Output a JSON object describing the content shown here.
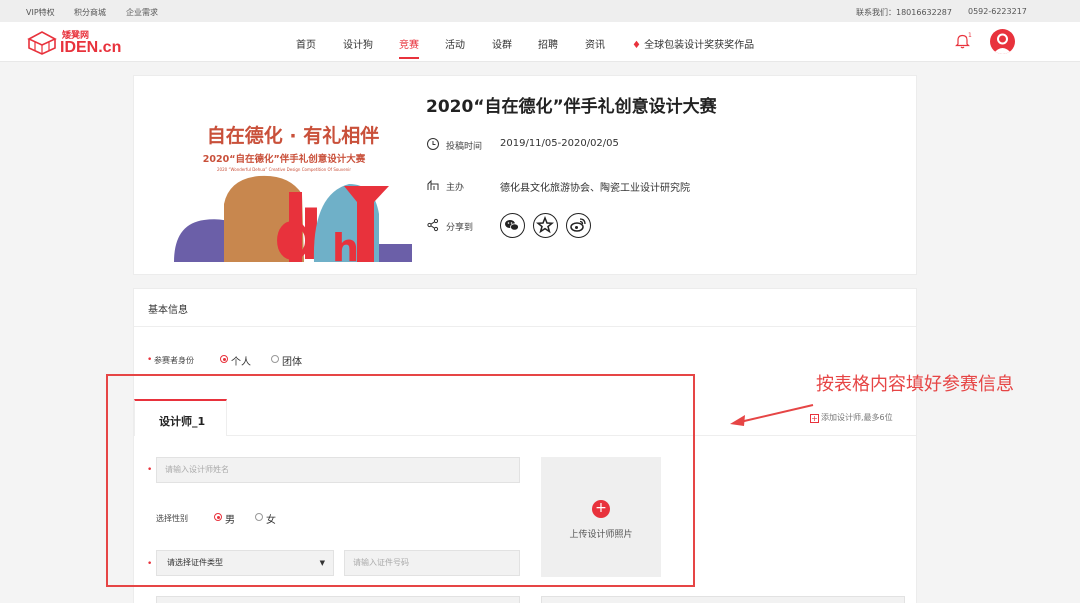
{
  "topbar": {
    "links": [
      "VIP特权",
      "积分商城",
      "企业需求"
    ],
    "contact": "联系我们：18016632287",
    "phone": "0592-6223217"
  },
  "brand": {
    "cn": "矮凳网",
    "en": "IDEN.cn",
    "color": "#e8323c"
  },
  "nav": {
    "items": [
      "首页",
      "设计狗",
      "竞赛",
      "活动",
      "设群",
      "招聘",
      "资讯",
      "全球包装设计奖获奖作品"
    ],
    "active_index": 2
  },
  "notification_count": "1",
  "contest": {
    "title": "2020“自在德化”伴手礼创意设计大赛",
    "banner": {
      "slogan": "自在德化 · 有礼相伴",
      "subtitle": "2020“自在德化”伴手礼创意设计大赛",
      "english": "2020 “Wonderful Dehua” Creative Design Competition Of Souvenir",
      "art_letters": [
        "d",
        "h"
      ]
    },
    "period_label": "投稿时间",
    "period_value": "2019/11/05-2020/02/05",
    "host_label": "主办",
    "host_value": "德化县文化旅游协会、陶瓷工业设计研究院",
    "share_label": "分享到",
    "share_icons": [
      "wechat-icon",
      "star-icon",
      "weibo-icon"
    ]
  },
  "basic_info": {
    "title": "基本信息",
    "identity_label": "参赛者身份",
    "identity_options": [
      "个人",
      "团体"
    ],
    "identity_selected": "个人"
  },
  "designer": {
    "tab_label": "设计师_1",
    "add_label": "添加设计师,最多6位",
    "name_placeholder": "请输入设计师姓名",
    "gender_label": "选择性别",
    "gender_options": [
      "男",
      "女"
    ],
    "gender_selected": "男",
    "id_type_value": "请选择证件类型",
    "id_number_placeholder": "请输入证件号码",
    "photo_label": "上传设计师照片"
  },
  "annotation": "按表格内容填好参赛信息"
}
